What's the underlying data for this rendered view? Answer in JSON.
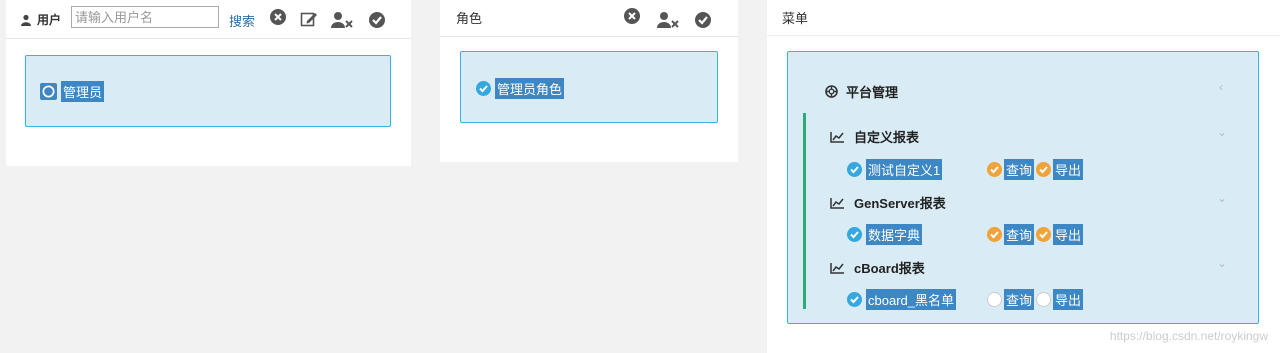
{
  "user_panel": {
    "label": "用户",
    "search_placeholder": "请输入用户名",
    "search_button": "搜索",
    "users": [
      {
        "name": "管理员",
        "selected": true
      }
    ]
  },
  "role_panel": {
    "title": "角色",
    "roles": [
      {
        "name": "管理员角色",
        "checked": true
      }
    ]
  },
  "menu_panel": {
    "title": "菜单",
    "root": {
      "label": "平台管理"
    },
    "groups": [
      {
        "title": "自定义报表",
        "item": "测试自定义1",
        "item_checked": true,
        "permissions": [
          {
            "label": "查询",
            "checked": true
          },
          {
            "label": "导出",
            "checked": true
          }
        ]
      },
      {
        "title": "GenServer报表",
        "item": "数据字典",
        "item_checked": true,
        "permissions": [
          {
            "label": "查询",
            "checked": true
          },
          {
            "label": "导出",
            "checked": true
          }
        ]
      },
      {
        "title": "cBoard报表",
        "item": "cboard_黑名单",
        "item_checked": true,
        "permissions": [
          {
            "label": "查询",
            "checked": false
          },
          {
            "label": "导出",
            "checked": false
          }
        ]
      }
    ]
  },
  "watermark": "https://blog.csdn.net/roykingw",
  "colors": {
    "accent_blue": "#3c87c4",
    "check_teal": "#35a8df",
    "check_orange": "#f0a33a",
    "tree_line": "#2eaa7a"
  }
}
